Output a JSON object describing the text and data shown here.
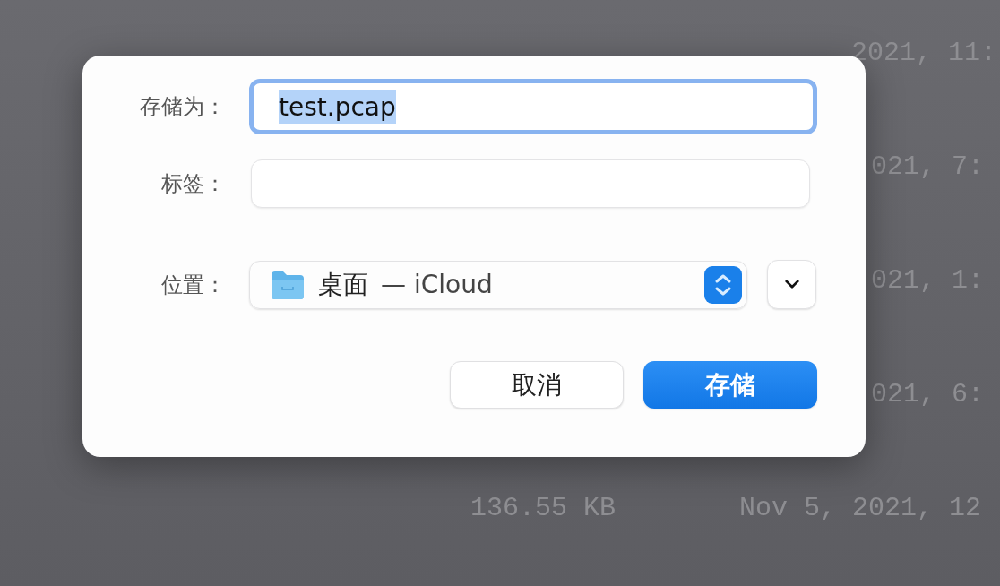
{
  "background_rows": [
    {
      "kind": "covered",
      "date": "2021, 11:"
    },
    {
      "kind": "covered",
      "date": "021, 7:"
    },
    {
      "kind": "covered",
      "date": "021, 1:"
    },
    {
      "kind": "covered",
      "date": "021, 6:"
    },
    {
      "kind": "full",
      "size": "136.55 KB",
      "date": "Nov 5, 2021, 12"
    }
  ],
  "dialog": {
    "save_as": {
      "label": "存储为：",
      "value": "test.pcap",
      "focused": true,
      "text_selected": true
    },
    "tags": {
      "label": "标签："
    },
    "location": {
      "label": "位置：",
      "folder": "桌面",
      "source": "— iCloud"
    },
    "buttons": [
      {
        "label": "取消",
        "kind": "cancel"
      },
      {
        "label": "存储",
        "kind": "default"
      }
    ]
  }
}
